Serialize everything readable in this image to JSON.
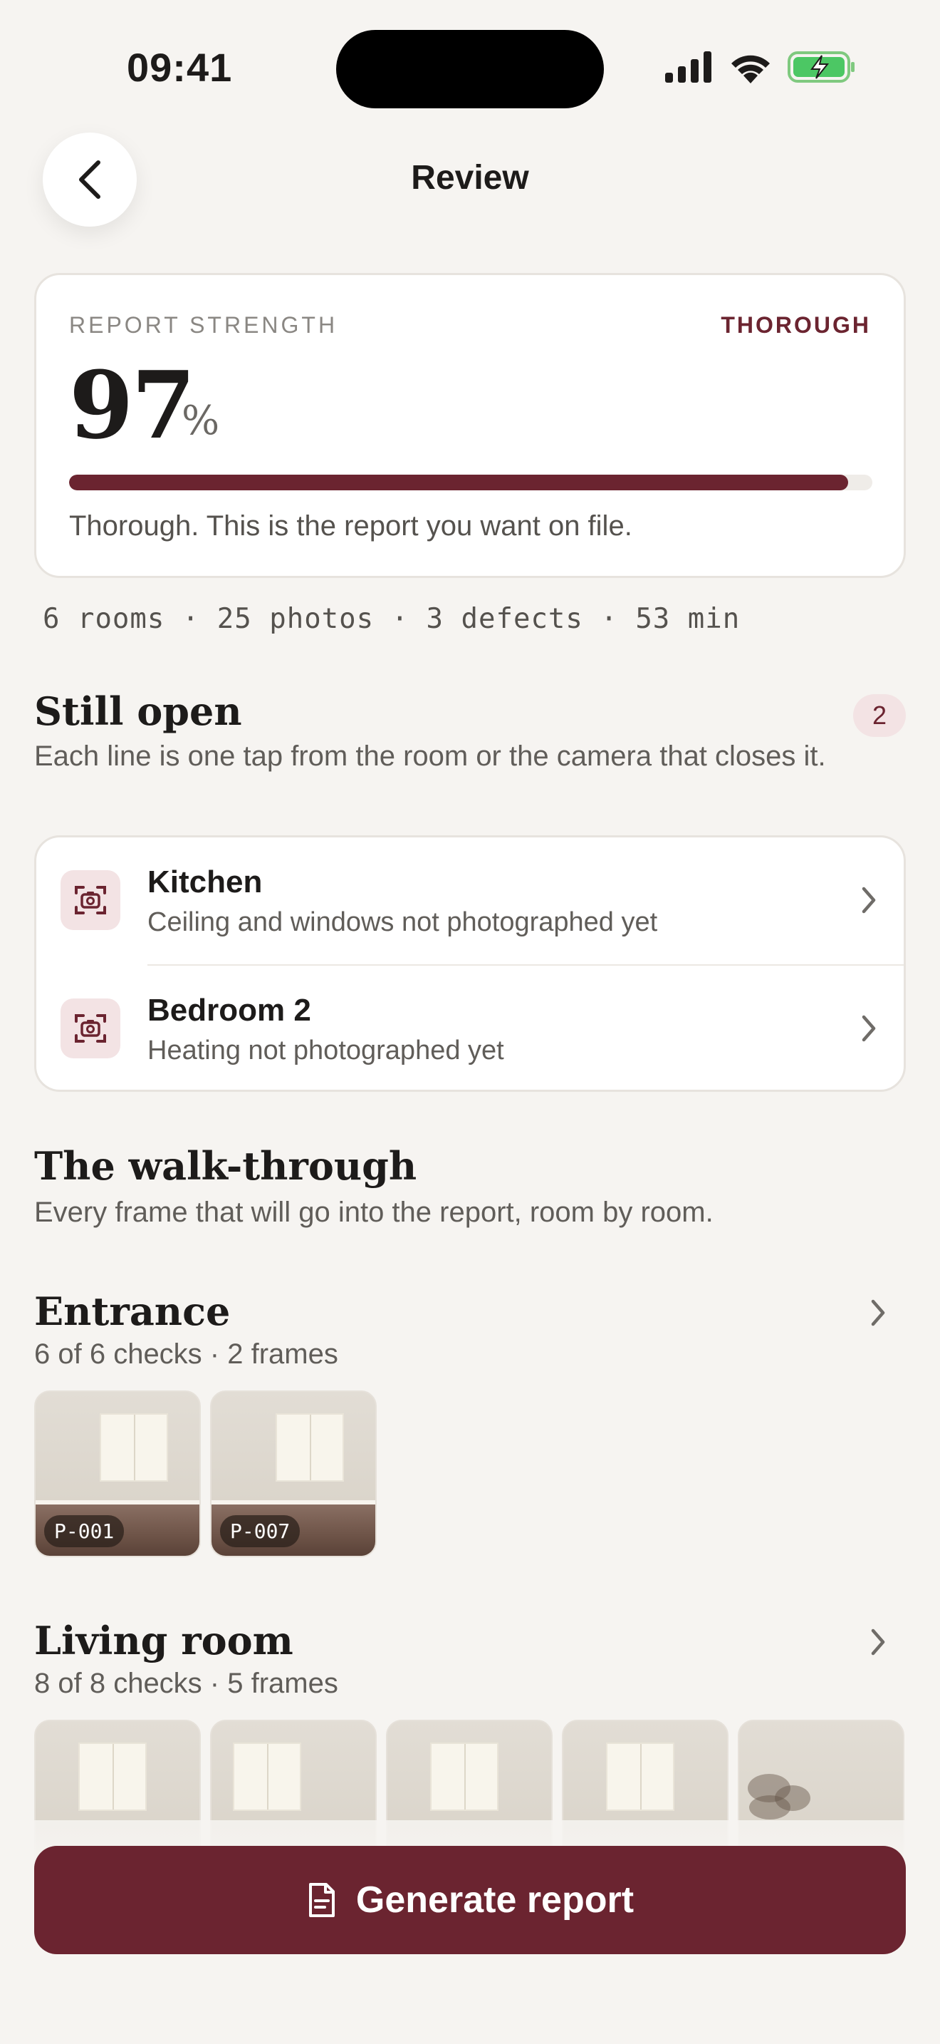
{
  "status_bar": {
    "time": "09:41"
  },
  "header": {
    "title": "Review",
    "back_icon": "chevron-left-icon"
  },
  "strength": {
    "label": "REPORT STRENGTH",
    "level": "THOROUGH",
    "value": "97",
    "unit": "%",
    "progress": 0.97,
    "description": "Thorough. This is the report you want on file."
  },
  "summary": "6 rooms · 25 photos · 3 defects · 53 min",
  "still_open": {
    "title": "Still open",
    "count": "2",
    "subtitle": "Each line is one tap from the room or the camera that closes it.",
    "items": [
      {
        "room": "Kitchen",
        "detail": "Ceiling and windows not photographed yet",
        "icon": "camera-icon"
      },
      {
        "room": "Bedroom 2",
        "detail": "Heating not photographed yet",
        "icon": "camera-icon"
      }
    ]
  },
  "walkthrough": {
    "title": "The walk-through",
    "subtitle": "Every frame that will go into the report, room by room."
  },
  "rooms": [
    {
      "name": "Entrance",
      "meta": "6 of 6 checks · 2 frames",
      "frames": [
        "P-001",
        "P-007"
      ]
    },
    {
      "name": "Living room",
      "meta": "8 of 8 checks · 5 frames"
    }
  ],
  "action": {
    "label": "Generate report",
    "icon": "document-icon"
  },
  "colors": {
    "accent": "#6b2430",
    "background": "#f6f4f1",
    "badge_bg": "#f3e3e4"
  }
}
